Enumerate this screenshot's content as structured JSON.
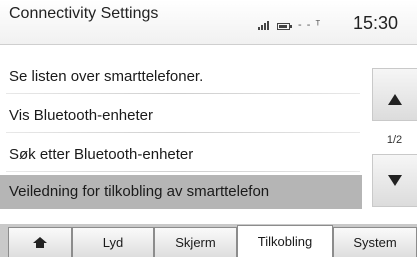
{
  "header": {
    "title": "Connectivity Settings",
    "network_text": "- - ᵀ",
    "clock": "15:30",
    "signal_icon": "signal-bars-icon",
    "battery_icon": "battery-icon"
  },
  "list": {
    "items": [
      {
        "label": "Se listen over smarttelefoner.",
        "selected": false
      },
      {
        "label": "Vis Bluetooth-enheter",
        "selected": false
      },
      {
        "label": "Søk etter Bluetooth-enheter",
        "selected": false
      },
      {
        "label": "Veiledning for tilkobling av smarttelefon",
        "selected": true
      }
    ]
  },
  "scroll": {
    "up_icon": "arrow-up-icon",
    "down_icon": "arrow-down-icon",
    "page_indicator": "1/2"
  },
  "tabs": [
    {
      "icon": "home-icon",
      "label": "",
      "active": false
    },
    {
      "label": "Lyd",
      "active": false
    },
    {
      "label": "Skjerm",
      "active": false
    },
    {
      "label": "Tilkobling",
      "active": true
    },
    {
      "label": "System",
      "active": false
    }
  ],
  "colors": {
    "selected_row": "#b5b5b5",
    "tabbar_bg": "#c9c9c9"
  }
}
